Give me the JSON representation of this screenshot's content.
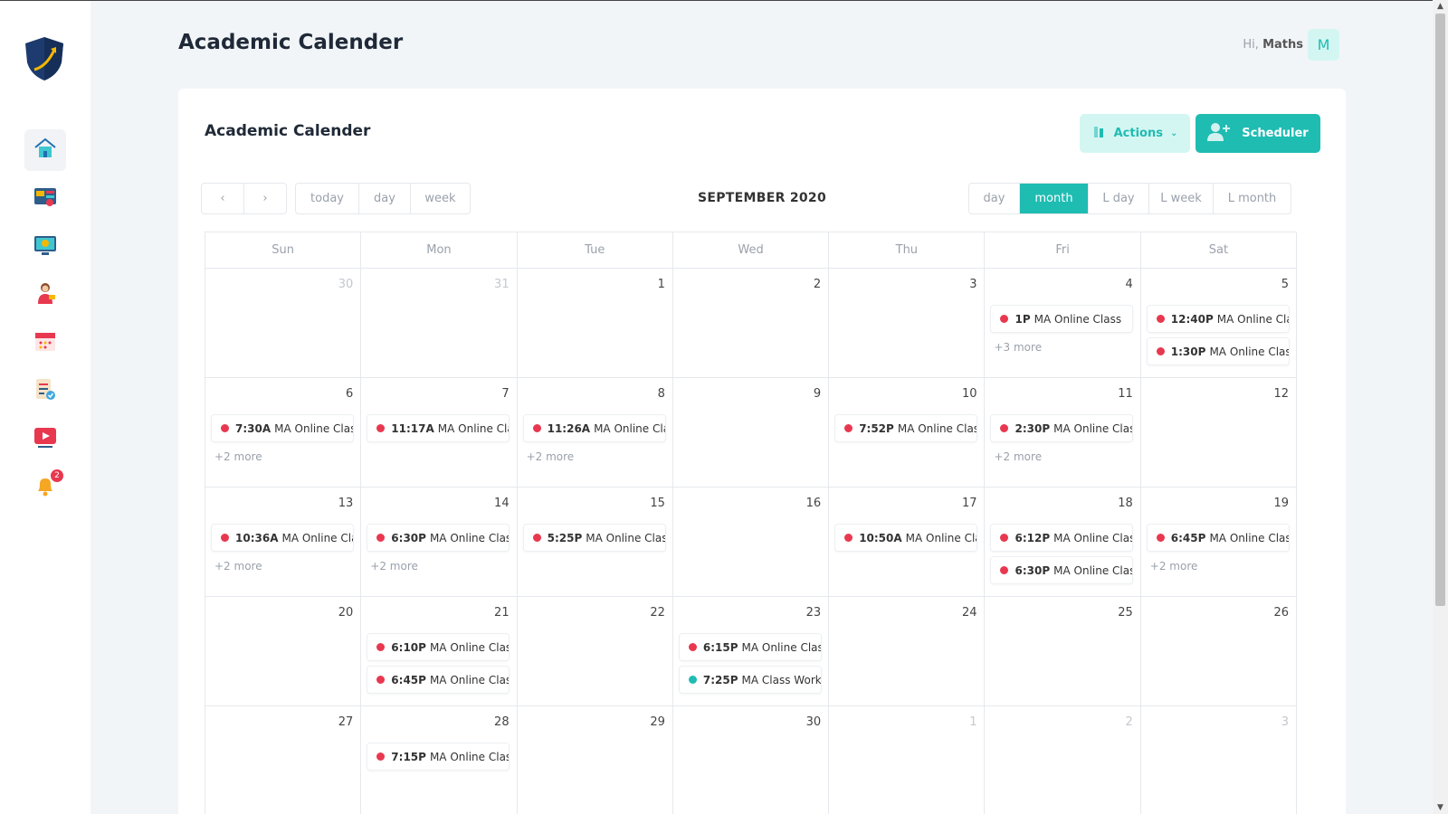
{
  "page_title": "Academic Calender",
  "user": {
    "greeting": "Hi,",
    "name": "Maths",
    "avatar_letter": "M"
  },
  "card": {
    "title": "Academic Calender",
    "actions_label": "Actions",
    "scheduler_label": "Scheduler"
  },
  "calendar": {
    "title": "SEPTEMBER 2020",
    "nav": {
      "prev": "‹",
      "next": "›"
    },
    "left_views": [
      "today",
      "day",
      "week"
    ],
    "right_views": [
      "day",
      "month",
      "L day",
      "L week",
      "L month"
    ],
    "active_view": "month",
    "weekdays": [
      "Sun",
      "Mon",
      "Tue",
      "Wed",
      "Thu",
      "Fri",
      "Sat"
    ],
    "weeks": [
      [
        {
          "d": "30",
          "other": true,
          "events": []
        },
        {
          "d": "31",
          "other": true,
          "events": []
        },
        {
          "d": "1",
          "events": []
        },
        {
          "d": "2",
          "events": []
        },
        {
          "d": "3",
          "events": []
        },
        {
          "d": "4",
          "events": [
            {
              "time": "1P",
              "title": "MA Online Class"
            }
          ],
          "more": "+3 more"
        },
        {
          "d": "5",
          "events": [
            {
              "time": "12:40P",
              "title": "MA Online Class"
            },
            {
              "time": "1:30P",
              "title": "MA Online Class"
            }
          ]
        }
      ],
      [
        {
          "d": "6",
          "events": [
            {
              "time": "7:30A",
              "title": "MA Online Class"
            }
          ],
          "more": "+2 more"
        },
        {
          "d": "7",
          "events": [
            {
              "time": "11:17A",
              "title": "MA Online Class"
            }
          ]
        },
        {
          "d": "8",
          "events": [
            {
              "time": "11:26A",
              "title": "MA Online Class"
            }
          ],
          "more": "+2 more"
        },
        {
          "d": "9",
          "events": []
        },
        {
          "d": "10",
          "events": [
            {
              "time": "7:52P",
              "title": "MA Online Class"
            }
          ]
        },
        {
          "d": "11",
          "events": [
            {
              "time": "2:30P",
              "title": "MA Online Class"
            }
          ],
          "more": "+2 more"
        },
        {
          "d": "12",
          "events": []
        }
      ],
      [
        {
          "d": "13",
          "events": [
            {
              "time": "10:36A",
              "title": "MA Online Class"
            }
          ],
          "more": "+2 more"
        },
        {
          "d": "14",
          "events": [
            {
              "time": "6:30P",
              "title": "MA Online Class"
            }
          ],
          "more": "+2 more"
        },
        {
          "d": "15",
          "events": [
            {
              "time": "5:25P",
              "title": "MA Online Class"
            }
          ]
        },
        {
          "d": "16",
          "events": []
        },
        {
          "d": "17",
          "events": [
            {
              "time": "10:50A",
              "title": "MA Online Class"
            }
          ]
        },
        {
          "d": "18",
          "events": [
            {
              "time": "6:12P",
              "title": "MA Online Class"
            },
            {
              "time": "6:30P",
              "title": "MA Online Class"
            }
          ]
        },
        {
          "d": "19",
          "events": [
            {
              "time": "6:45P",
              "title": "MA Online Class"
            }
          ],
          "more": "+2 more"
        }
      ],
      [
        {
          "d": "20",
          "events": []
        },
        {
          "d": "21",
          "events": [
            {
              "time": "6:10P",
              "title": "MA Online Class"
            },
            {
              "time": "6:45P",
              "title": "MA Online Class"
            }
          ]
        },
        {
          "d": "22",
          "events": []
        },
        {
          "d": "23",
          "events": [
            {
              "time": "6:15P",
              "title": "MA Online Class"
            },
            {
              "time": "7:25P",
              "title": "MA Class Work",
              "teal": true
            }
          ]
        },
        {
          "d": "24",
          "events": []
        },
        {
          "d": "25",
          "events": []
        },
        {
          "d": "26",
          "events": []
        }
      ],
      [
        {
          "d": "27",
          "events": []
        },
        {
          "d": "28",
          "events": [
            {
              "time": "7:15P",
              "title": "MA Online Class"
            }
          ]
        },
        {
          "d": "29",
          "events": []
        },
        {
          "d": "30",
          "events": []
        },
        {
          "d": "1",
          "other": true,
          "events": []
        },
        {
          "d": "2",
          "other": true,
          "events": []
        },
        {
          "d": "3",
          "other": true,
          "events": []
        }
      ]
    ]
  },
  "sidebar": {
    "items": [
      {
        "icon": "home-icon",
        "active": true
      },
      {
        "icon": "dashboard-icon"
      },
      {
        "icon": "monitor-icon"
      },
      {
        "icon": "teacher-icon"
      },
      {
        "icon": "calendar-icon"
      },
      {
        "icon": "checklist-icon"
      },
      {
        "icon": "video-icon"
      },
      {
        "icon": "bell-icon",
        "badge": "2"
      }
    ]
  },
  "colors": {
    "accent": "#1fbcb2",
    "accent_light": "#d4f6f3",
    "event_dot": "#e8384f"
  }
}
